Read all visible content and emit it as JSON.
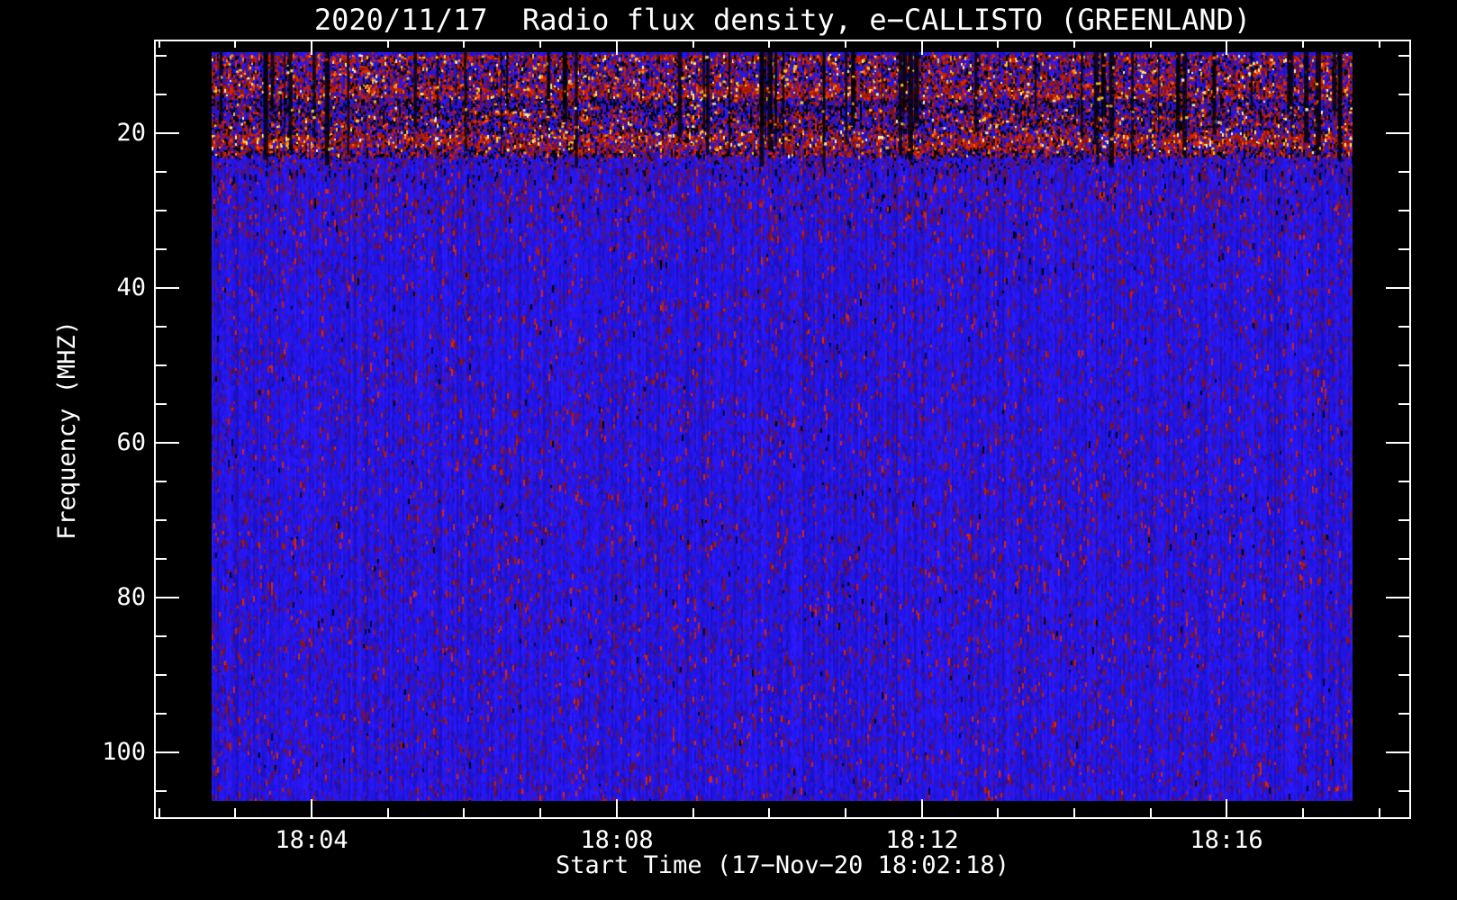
{
  "title": "2020/11/17  Radio flux density, e−CALLISTO (GREENLAND)",
  "x_axis": {
    "title": "Start Time (17−Nov−20 18:02:18)",
    "major_ticks": [
      {
        "minute": 4,
        "label": "18:04"
      },
      {
        "minute": 8,
        "label": "18:08"
      },
      {
        "minute": 12,
        "label": "18:12"
      },
      {
        "minute": 16,
        "label": "18:16"
      }
    ],
    "minor_tick_minutes": [
      2,
      3,
      4,
      5,
      6,
      7,
      8,
      9,
      10,
      11,
      12,
      13,
      14,
      15,
      16,
      17,
      18
    ]
  },
  "y_axis": {
    "title": "Frequency (MHZ)",
    "major_ticks": [
      {
        "mhz": 20,
        "label": "20"
      },
      {
        "mhz": 40,
        "label": "40"
      },
      {
        "mhz": 60,
        "label": "60"
      },
      {
        "mhz": 80,
        "label": "80"
      },
      {
        "mhz": 100,
        "label": "100"
      }
    ],
    "minor_tick_mhz": [
      10,
      15,
      20,
      25,
      30,
      35,
      40,
      45,
      50,
      55,
      60,
      65,
      70,
      75,
      80,
      85,
      90,
      95,
      100,
      105
    ]
  },
  "palette": {
    "background": "#000000",
    "frame": "#ffffff",
    "text": "#ffffff",
    "blues": [
      "#2b1aff",
      "#2617f0",
      "#2114dd",
      "#1b10c4"
    ],
    "darks": [
      "#4a12b0",
      "#3a0d85",
      "#55106e",
      "#6b1040"
    ],
    "reds": [
      "#c21f05",
      "#a81a04",
      "#8f1503",
      "#d92708"
    ],
    "brights": [
      "#ff8c1a",
      "#ffc72e",
      "#fff3a0",
      "#ff5510"
    ],
    "blacks": [
      "#000000",
      "#02021a",
      "#05053a"
    ],
    "body_red_dot": "#7a1238",
    "body_red_dot_bright": "#a01828"
  },
  "chart_data": {
    "type": "heatmap",
    "title": "2020/11/17  Radio flux density, e−CALLISTO (GREENLAND)",
    "xlabel": "Start Time (17−Nov−20 18:02:18)",
    "ylabel": "Frequency (MHZ)",
    "instrument": "e-CALLISTO (GREENLAND)",
    "date": "2020/11/17",
    "start_time": "18:02:18",
    "x_range_time": [
      "18:01:55",
      "18:18:26"
    ],
    "data_time_span": [
      "18:02:45",
      "18:17:08"
    ],
    "x_major_tick_labels": [
      "18:04",
      "18:08",
      "18:12",
      "18:16"
    ],
    "x_minor_tick_interval_min": 1,
    "y_range_mhz": [
      7.9,
      108.6
    ],
    "data_freq_span_mhz": [
      9.6,
      106.3
    ],
    "y_major_ticks_mhz": [
      20,
      40,
      60,
      80,
      100
    ],
    "y_minor_tick_interval_mhz": 5,
    "y_axis_inverted": true,
    "grid": false,
    "legend": "none",
    "colormap": "CALLISTO blue–red–yellow; quiet background renders blue, strong interference red/yellow, dropouts black",
    "content_summary": "Quiet solar radio spectrogram: broadband ionospheric/RFI emission band between ~10 and ~24 MHz with red/yellow speckle and black time dropouts; uniform blue background noise from ~24 to ~106 MHz; no solar burst visible",
    "rfi_bands": [
      {
        "f0": 9.6,
        "f1": 10.3,
        "black": 0.12,
        "red": 0.5,
        "bright": 0.08,
        "dark": 0.1
      },
      {
        "f0": 10.3,
        "f1": 13.6,
        "black": 0.18,
        "red": 0.32,
        "bright": 0.05,
        "dark": 0.12
      },
      {
        "f0": 13.6,
        "f1": 15.4,
        "black": 0.12,
        "red": 0.48,
        "bright": 0.08,
        "dark": 0.1
      },
      {
        "f0": 15.4,
        "f1": 17.0,
        "black": 0.32,
        "red": 0.12,
        "bright": 0.01,
        "dark": 0.25
      },
      {
        "f0": 17.0,
        "f1": 19.9,
        "black": 0.24,
        "red": 0.28,
        "bright": 0.03,
        "dark": 0.15
      },
      {
        "f0": 19.9,
        "f1": 21.8,
        "black": 0.1,
        "red": 0.5,
        "bright": 0.09,
        "dark": 0.08
      },
      {
        "f0": 21.8,
        "f1": 23.0,
        "black": 0.26,
        "red": 0.3,
        "bright": 0.02,
        "dark": 0.2
      },
      {
        "f0": 23.0,
        "f1": 25.8,
        "black": 0.06,
        "red": 0.05,
        "bright": 0.0,
        "dark": 0.3
      },
      {
        "f0": 25.8,
        "f1": 30.5,
        "black": 0.02,
        "red": 0.06,
        "bright": 0.0,
        "dark": 0.2
      },
      {
        "f0": 30.5,
        "f1": 33.5,
        "black": 0.006,
        "red": 0.05,
        "bright": 0.0,
        "dark": 0.13
      },
      {
        "f0": 33.5,
        "f1": 106.4,
        "black": 0.004,
        "red": 0.035,
        "bright": 0.0,
        "dark": 0.11
      }
    ],
    "dropout_streaks": {
      "count": 60,
      "freq_span_mhz": [
        9.6,
        24.5
      ]
    }
  }
}
